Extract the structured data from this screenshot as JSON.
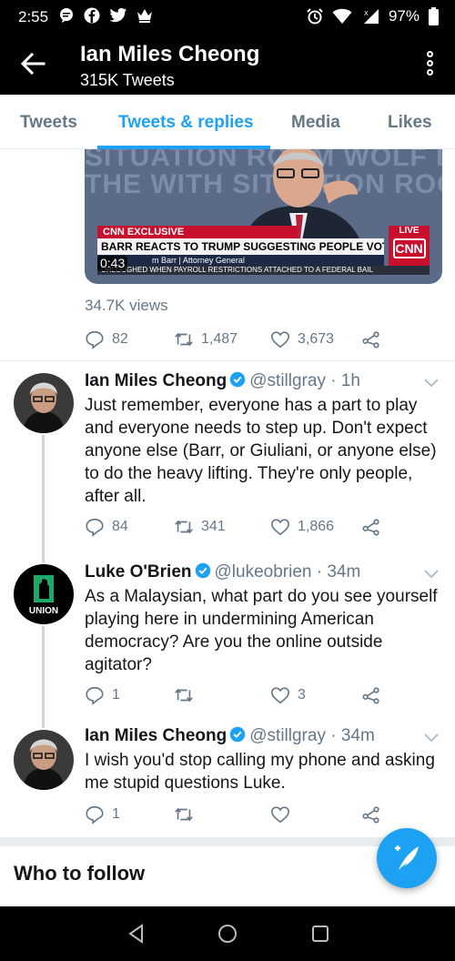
{
  "status_bar": {
    "time": "2:55",
    "battery": "97%",
    "left_icons": [
      "chat-bubble-icon",
      "facebook-icon",
      "twitter-icon",
      "crown-icon"
    ],
    "right_icons": [
      "alarm-icon",
      "wifi-icon",
      "cell-signal-icon",
      "battery-icon"
    ]
  },
  "app_bar": {
    "title": "Ian Miles Cheong",
    "subtitle": "315K Tweets"
  },
  "tabs": [
    {
      "label": "Tweets",
      "active": false
    },
    {
      "label": "Tweets & replies",
      "active": true
    },
    {
      "label": "Media",
      "active": false
    },
    {
      "label": "Likes",
      "active": false
    }
  ],
  "video_tweet": {
    "duration": "0:43",
    "cnn_label": "CNN EXCLUSIVE",
    "headline": "BARR REACTS TO TRUMP SUGGESTING PEOPLE VOTE TWICE",
    "name_bar": "m Barr | Attorney General",
    "ticker": "URLOUGHED WHEN PAYROLL RESTRICTIONS ATTACHED TO A FEDERAL BAIL",
    "live_label": "LIVE",
    "network": "CNN",
    "views": "34.7K views",
    "replies": "82",
    "retweets": "1,487",
    "likes": "3,673"
  },
  "tweets": [
    {
      "name": "Ian Miles Cheong",
      "handle": "@stillgray",
      "time": "1h",
      "text": "Just remember, everyone has a part to play and everyone needs to step up. Don't expect anyone else (Barr, or Giuliani, or anyone else) to do the heavy lifting. They're only people, after all.",
      "replies": "84",
      "retweets": "341",
      "likes": "1,866"
    },
    {
      "name": "Luke O'Brien",
      "handle": "@lukeobrien",
      "time": "34m",
      "avatar_label": "UNION",
      "text": "As a Malaysian, what part do you see yourself playing here in undermining American democracy? Are you the online outside agitator?",
      "replies": "1",
      "retweets": "",
      "likes": "3"
    },
    {
      "name": "Ian Miles Cheong",
      "handle": "@stillgray",
      "time": "34m",
      "text": "I wish you'd stop calling my phone and asking me stupid questions Luke.",
      "replies": "1",
      "retweets": "",
      "likes": ""
    }
  ],
  "who_to_follow": "Who to follow",
  "colors": {
    "accent": "#1da1f2",
    "muted": "#657786",
    "divider": "#e6ecf0",
    "thread_line": "#ccd6dd"
  }
}
